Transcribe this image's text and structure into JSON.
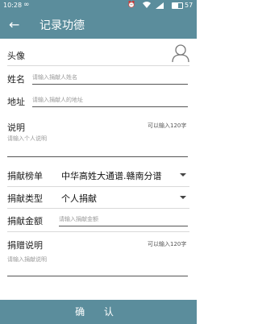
{
  "status_bar": {
    "time": "10:28",
    "battery_percent": "57",
    "icons": [
      "infinity-icon",
      "alarm-icon",
      "wifi-icon",
      "signal-icon",
      "battery-icon"
    ]
  },
  "app_bar": {
    "back_icon": "←",
    "title": "记录功德"
  },
  "form": {
    "avatar_label": "头像",
    "name_label": "姓名",
    "name_placeholder": "请输入捐献人姓名",
    "address_label": "地址",
    "address_placeholder": "请输入捐献人的地址",
    "description_label": "说明",
    "description_hint": "可以输入120字",
    "description_placeholder": "请输入个人说明",
    "ranking_label": "捐献榜单",
    "ranking_value": "中华高姓大通谱.赣南分谱",
    "type_label": "捐献类型",
    "type_value": "个人捐献",
    "amount_label": "捐献金额",
    "amount_placeholder": "请输入捐献金额",
    "donation_note_label": "捐赠说明",
    "donation_note_hint": "可以输入120字",
    "donation_note_placeholder": "请输入捐献说明"
  },
  "confirm_label": "确 认",
  "colors": {
    "primary": "#5b8d9c",
    "divider": "#d9d9d9",
    "placeholder": "#9a9a9a"
  }
}
